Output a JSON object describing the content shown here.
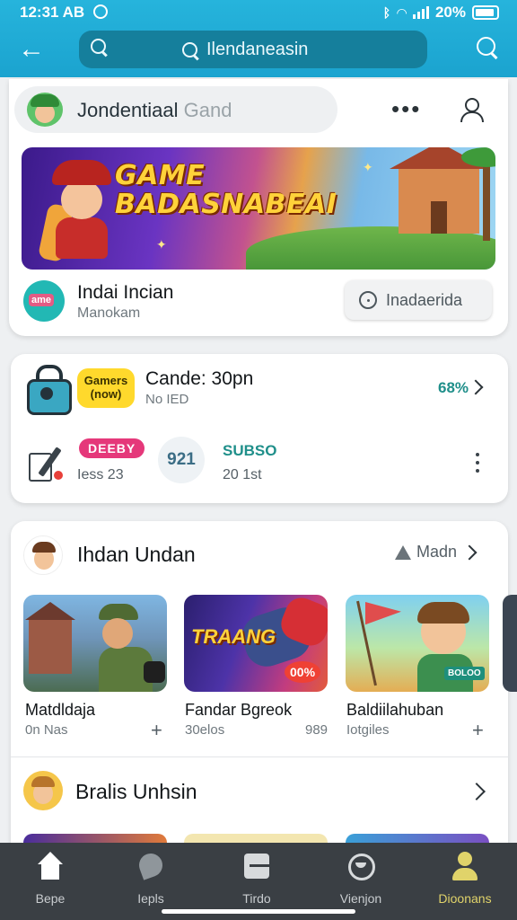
{
  "status_bar": {
    "time": "12:31 AB",
    "battery": "20%",
    "icons": [
      "clock-icon",
      "bluetooth-icon",
      "wifi-icon",
      "signal-icon",
      "battery-icon"
    ]
  },
  "header": {
    "search_text": "Ilendaneasin",
    "icons": [
      "back-arrow-icon",
      "search-icon"
    ]
  },
  "profile_chip": {
    "title": "Jondentiaal",
    "title_muted": "Gand"
  },
  "banner": {
    "line1": "GAME",
    "line2": "BADASNABEAI"
  },
  "featured_app": {
    "logo_text": "ame",
    "name": "Indai Incian",
    "subtitle": "Manokam",
    "action_label": "Inadaerida"
  },
  "promo_card": {
    "badge_line1": "Gamers",
    "badge_line2": "(now)",
    "title": "Cande: 30pn",
    "subtitle": "No IED",
    "percent": "68%",
    "pink_pill": "DEEBY",
    "left_stat": "Iess 23",
    "circle_value": "921",
    "teal_label": "SUBSO",
    "right_stat": "20 1st"
  },
  "section_one": {
    "title": "Ihdan Undan",
    "more_label": "Madn",
    "tiles": [
      {
        "title": "Matdldaja",
        "meta": "0n Nas",
        "meta_right": ""
      },
      {
        "title": "Fandar Bgreok",
        "meta": "30elos",
        "meta_right": "989",
        "overlay_word": "TRAANG",
        "discount": "00%"
      },
      {
        "title": "Baldiilahuban",
        "meta": "Iotgiles",
        "meta_right": "",
        "tag": "BOLOO"
      }
    ]
  },
  "section_two": {
    "title": "Bralis Unhsin"
  },
  "bottom_nav": {
    "items": [
      {
        "label": "Bepe",
        "icon": "home-icon"
      },
      {
        "label": "Iepls",
        "icon": "leaf-icon"
      },
      {
        "label": "Tirdo",
        "icon": "box-icon"
      },
      {
        "label": "Vienjon",
        "icon": "face-icon"
      },
      {
        "label": "Dioonans",
        "icon": "person-icon"
      }
    ],
    "active_index": 4
  },
  "colors": {
    "header": "#1ba3cf",
    "search_field": "#157f9c",
    "accent_teal": "#1f8f8a",
    "badge_yellow": "#ffd92c",
    "pill_pink": "#e5387a",
    "nav_bg": "#3a3f44",
    "nav_active": "#e0d36a"
  }
}
